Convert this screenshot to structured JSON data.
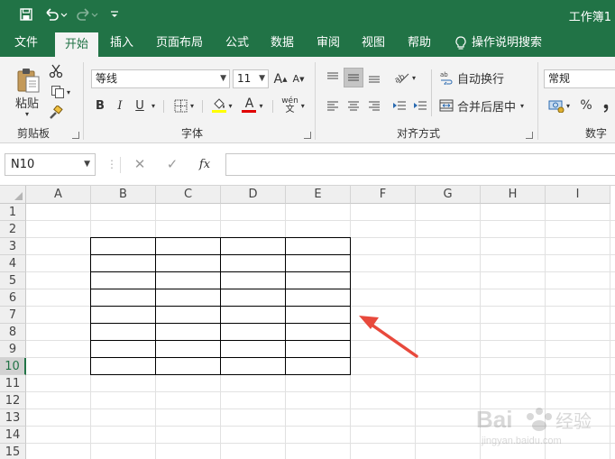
{
  "window": {
    "title": "工作簿1"
  },
  "quick_access": {
    "save_icon": "save-icon",
    "undo_icon": "undo-icon",
    "redo_icon": "redo-icon",
    "customize_icon": "chevron-down-icon"
  },
  "tabs": [
    {
      "label": "文件"
    },
    {
      "label": "开始"
    },
    {
      "label": "插入"
    },
    {
      "label": "页面布局"
    },
    {
      "label": "公式"
    },
    {
      "label": "数据"
    },
    {
      "label": "审阅"
    },
    {
      "label": "视图"
    },
    {
      "label": "帮助"
    }
  ],
  "active_tab": "开始",
  "tell_me": {
    "label": "操作说明搜索"
  },
  "ribbon": {
    "clipboard": {
      "paste_label": "粘贴",
      "group_label": "剪贴板"
    },
    "font": {
      "font_name": "等线",
      "font_size": "11",
      "bold": "B",
      "italic": "I",
      "underline": "U",
      "font_color_letter": "A",
      "phonetic_label": "wén",
      "grow_label": "A",
      "shrink_label": "A",
      "group_label": "字体"
    },
    "alignment": {
      "wrap_text_label": "自动换行",
      "merge_center_label": "合并后居中",
      "group_label": "对齐方式"
    },
    "number": {
      "format": "常规",
      "percent_label": "%",
      "group_label": "数字"
    }
  },
  "formula_bar": {
    "name_box": "N10",
    "cancel_symbol": "✕",
    "enter_symbol": "✓",
    "fx_label": "fx",
    "formula": ""
  },
  "sheet": {
    "columns": [
      "A",
      "B",
      "C",
      "D",
      "E",
      "F",
      "G",
      "H",
      "I"
    ],
    "rows": [
      "1",
      "2",
      "3",
      "4",
      "5",
      "6",
      "7",
      "8",
      "9",
      "10",
      "11",
      "12",
      "13",
      "14",
      "15"
    ],
    "active_row": "10",
    "bordered_range": "B3:E10"
  },
  "colors": {
    "brand": "#217346",
    "arrow": "#e8493c"
  },
  "watermark": {
    "text": "Bai 经验",
    "sub": "jingyan.baidu.com"
  }
}
